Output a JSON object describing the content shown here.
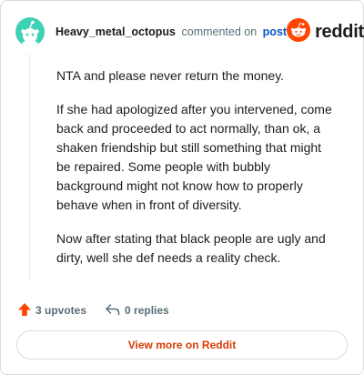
{
  "header": {
    "username": "Heavy_metal_octopus",
    "action_text": "commented on",
    "post_link": "post",
    "brand_name": "reddit"
  },
  "comment": {
    "paragraphs": [
      "NTA and please never return the money.",
      "If she had apologized after you intervened, come back and proceeded to act normally, than ok, a shaken friendship but still something that might be repaired. Some people with bubbly background might not know how to properly behave when in front of diversity.",
      "Now after stating that black people are ugly and dirty, well she def needs a reality check."
    ]
  },
  "actions": {
    "upvotes": "3 upvotes",
    "replies": "0 replies"
  },
  "footer": {
    "view_more": "View more on Reddit"
  },
  "colors": {
    "avatar_bg": "#3fd1b5",
    "upvote_arrow": "#ff4500",
    "brand_orange": "#ff4500",
    "link_blue": "#0a56c2",
    "view_more_text": "#d93a00"
  },
  "icons": {
    "avatar": "snoo-avatar-icon",
    "brand": "reddit-logo-icon",
    "upvote": "upvote-arrow-icon",
    "reply": "reply-arrow-icon"
  }
}
